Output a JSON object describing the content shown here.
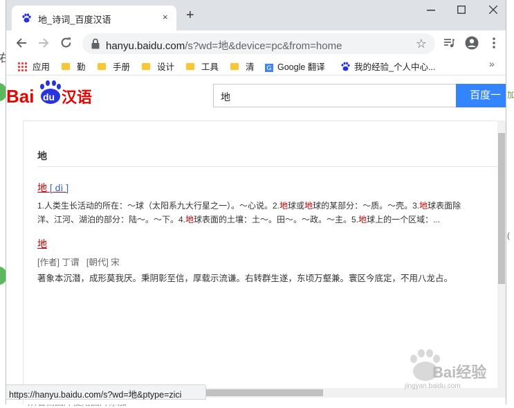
{
  "background": {
    "left_text": "右",
    "right_text_top": "加",
    "right_text_mid": "(",
    "bottom_text": "从右侧图库使用图片添加"
  },
  "browser": {
    "tab_title": "地_诗词_百度汉语",
    "tab_close": "×",
    "new_tab": "+",
    "url_host": "hanyu.baidu.com",
    "url_path": "/s?wd=地&device=pc&from=home"
  },
  "bookmarks": [
    {
      "label": "应用",
      "icon": "apps-grid-icon"
    },
    {
      "label": "勤",
      "icon": "folder-icon"
    },
    {
      "label": "手册",
      "icon": "folder-icon"
    },
    {
      "label": "设计",
      "icon": "folder-icon"
    },
    {
      "label": "工具",
      "icon": "folder-icon"
    },
    {
      "label": "清",
      "icon": "folder-icon"
    },
    {
      "label": "Google 翻译",
      "icon": "google-translate-icon"
    },
    {
      "label": "我的经验_个人中心...",
      "icon": "baidu-paw-icon"
    }
  ],
  "page": {
    "logo_text": "Baidu汉语",
    "search_value": "地",
    "search_button": "百度一",
    "card_title": "地",
    "entry_char": "地",
    "entry_pinyin": "[ dì ]",
    "entry_def_line1_parts": [
      "1.人类生长活动的所在：～球（太阳系九大行星之一）。～心说。2.",
      "地",
      "球或",
      "地",
      "球的某部分：～质。～壳。3.",
      "地",
      "球表面除"
    ],
    "entry_def_line2_parts": [
      "洋、江河、湖泊的部分：陆～。～下。4.",
      "地",
      "球表面的土壤：土～。田～。～政。～主。5.",
      "地",
      "球上的一个区域：..."
    ],
    "poem_title": "地",
    "poem_author_label": "[作者] 丁谓",
    "poem_dynasty_label": "[朝代] 宋",
    "poem_text": "著象本沉潜，成形莫我厌。秉阴彰至信，厚载示流谦。右转群生遂，东顷万壑兼。寰区今底定，不用八龙占。"
  },
  "status_url": "https://hanyu.baidu.com/s?wd=地&ptype=zici",
  "watermark": {
    "text": "Bai经验",
    "sub": "jingyan.baidu.com"
  }
}
